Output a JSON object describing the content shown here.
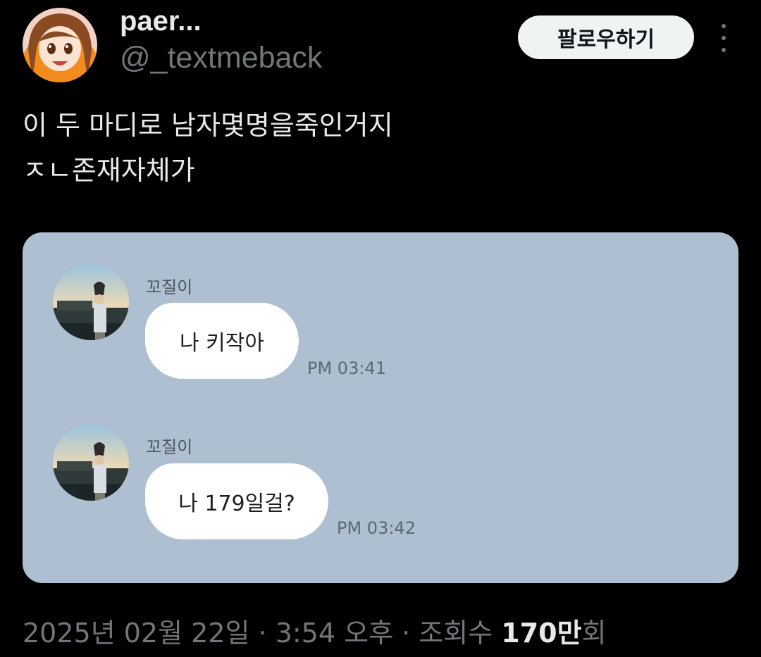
{
  "author": {
    "display_name": "paer...",
    "handle": "@_textmeback",
    "avatar_icon": "anime-girl-avatar"
  },
  "follow_button_label": "팔로우하기",
  "more_icon": "more-vertical-icon",
  "tweet": {
    "text": "이 두 마디로 남자몇명을죽인거지\nㅈㄴ존재자체가"
  },
  "chat": {
    "background": "#adbfd0",
    "messages": [
      {
        "sender": "꼬질이",
        "text": "나 키작아",
        "time": "PM 03:41"
      },
      {
        "sender": "꼬질이",
        "text": "나 179일걸?",
        "time": "PM 03:42"
      }
    ]
  },
  "meta": {
    "date": "2025년 02월 22일",
    "sep1": " · ",
    "time": "3:54 오후",
    "sep2": " · ",
    "views_label": "조회수 ",
    "views_count": "170만",
    "views_suffix": "회"
  }
}
